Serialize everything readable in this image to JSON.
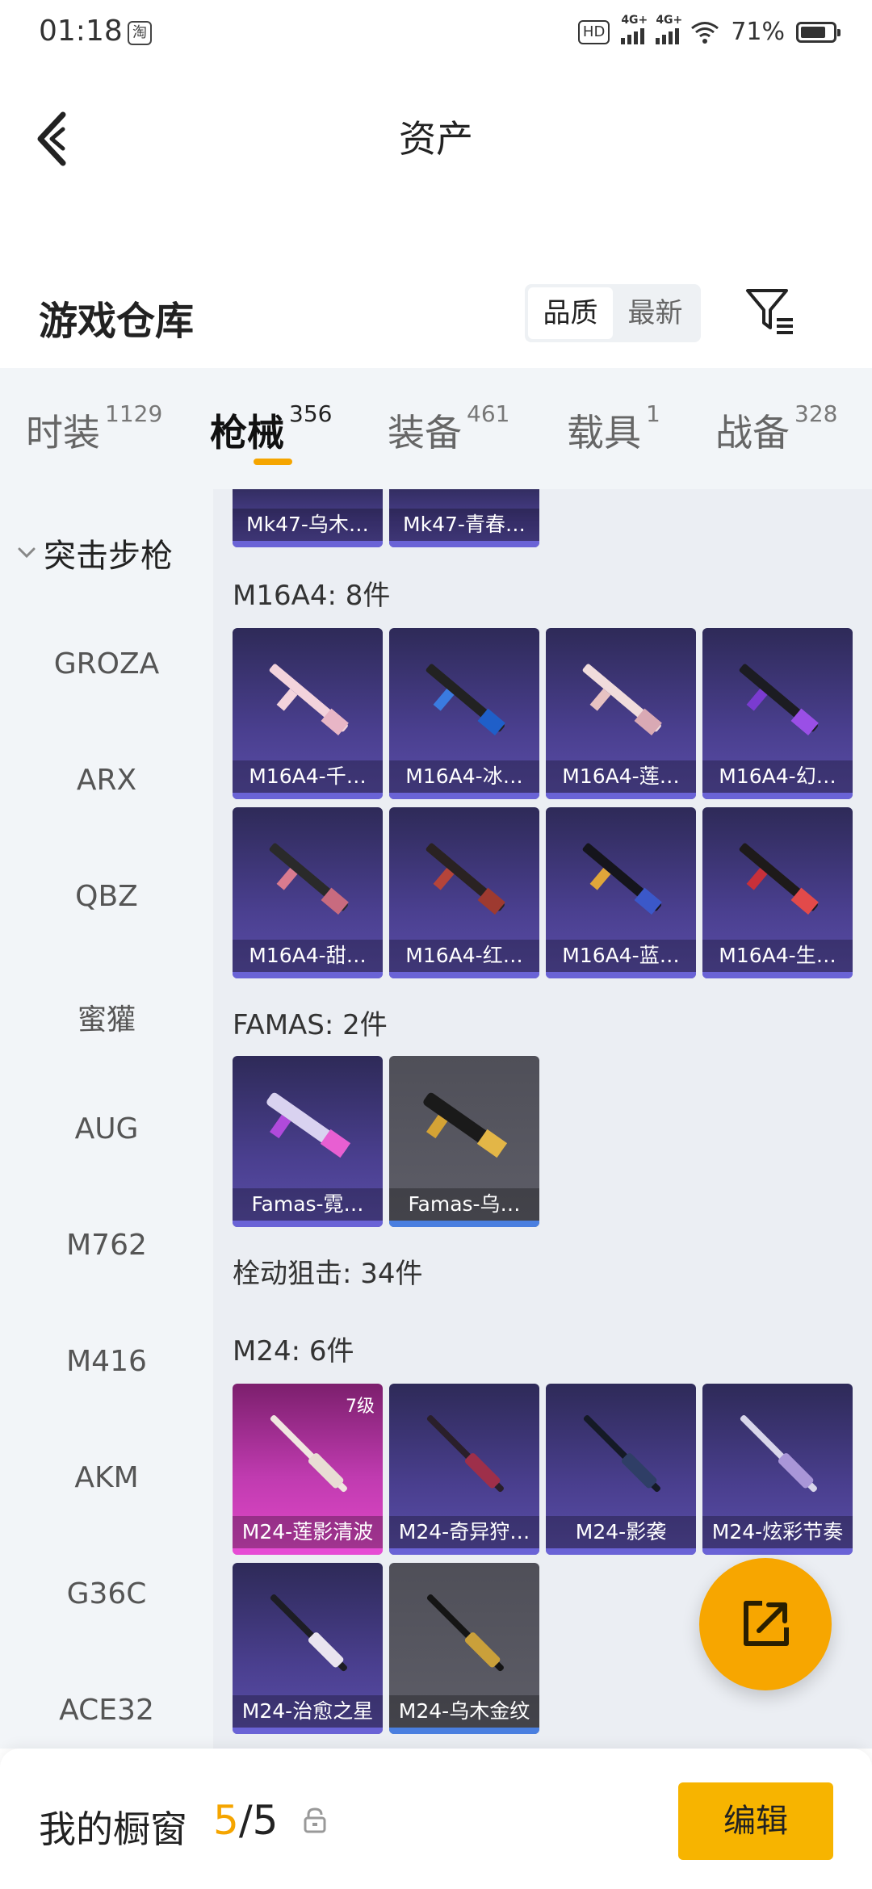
{
  "status_bar": {
    "time": "01:18",
    "app_icon": "淘",
    "hd_badge": "HD",
    "network_1": "4G+",
    "network_2": "4G+",
    "battery": "71%"
  },
  "header": {
    "title": "资产"
  },
  "warehouse": {
    "title": "游戏仓库",
    "sort_options": [
      "品质",
      "最新"
    ],
    "sort_selected": "品质"
  },
  "tabs": [
    {
      "name": "时装",
      "count": "1129"
    },
    {
      "name": "枪械",
      "count": "356",
      "active": true
    },
    {
      "name": "装备",
      "count": "461"
    },
    {
      "name": "载具",
      "count": "1"
    },
    {
      "name": "战备",
      "count": "328"
    }
  ],
  "sidebar": {
    "group": "突击步枪",
    "items": [
      "GROZA",
      "ARX",
      "QBZ",
      "蜜獾",
      "AUG",
      "M762",
      "M416",
      "AKM",
      "G36C",
      "ACE32"
    ]
  },
  "sections": {
    "top_cut": [
      "Mk47-乌木…",
      "Mk47-青春…"
    ],
    "m16": {
      "title": "M16A4: 8件",
      "items": [
        "M16A4-千…",
        "M16A4-冰…",
        "M16A4-莲…",
        "M16A4-幻…",
        "M16A4-甜…",
        "M16A4-红…",
        "M16A4-蓝…",
        "M16A4-生…"
      ]
    },
    "famas": {
      "title": "FAMAS: 2件",
      "items": [
        "Famas-霓…",
        "Famas-乌…"
      ]
    },
    "bolt": {
      "title": "栓动狙击: 34件"
    },
    "m24": {
      "title": "M24: 6件",
      "level_badge": "7级",
      "items": [
        "M24-莲影清波",
        "M24-奇异狩…",
        "M24-影袭",
        "M24-炫彩节奏",
        "M24-治愈之星",
        "M24-乌木金纹"
      ]
    }
  },
  "bottom_bar": {
    "label": "我的橱窗",
    "current": "5",
    "separator": "/",
    "total": "5",
    "edit_label": "编辑"
  },
  "colors": {
    "accent": "#f7a600",
    "card_purple": "#4a3f8f",
    "card_gray": "#5e5e68",
    "card_pink": "#c03bb0"
  },
  "icons": [
    "back-arrow-icon",
    "filter-icon",
    "lock-icon",
    "share-icon",
    "chevron-down-icon",
    "wifi-icon",
    "battery-icon"
  ]
}
